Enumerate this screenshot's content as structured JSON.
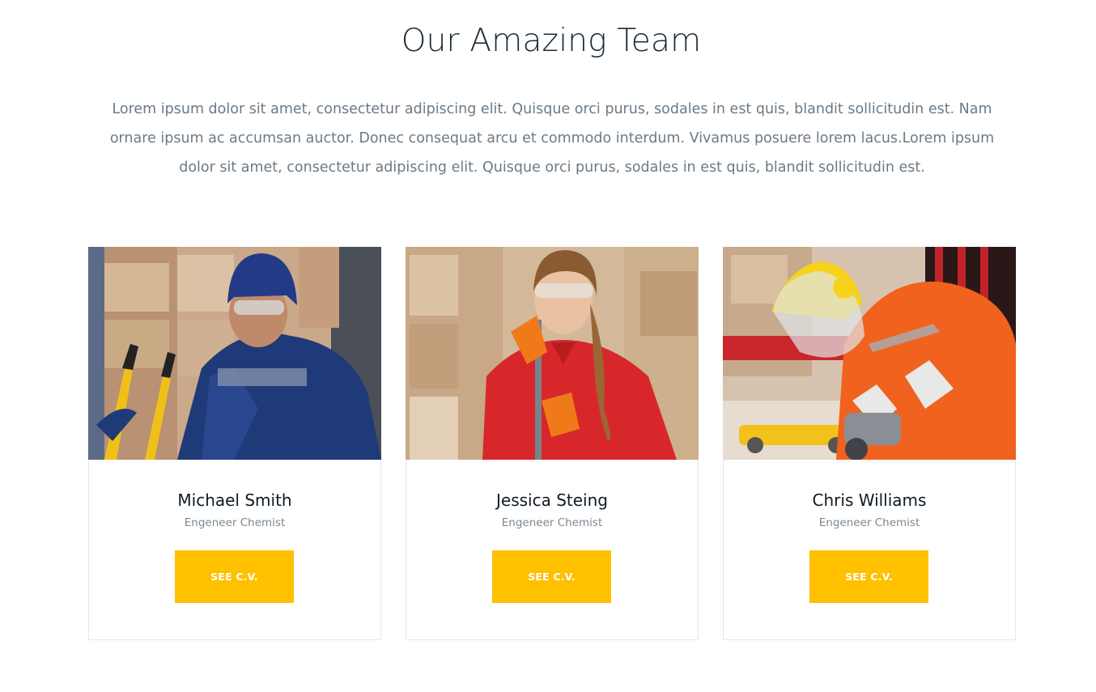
{
  "section": {
    "title": "Our Amazing Team",
    "intro": "Lorem ipsum dolor sit amet, consectetur adipiscing elit. Quisque orci purus, sodales in est quis, blandit sollicitudin est. Nam ornare ipsum ac accumsan auctor. Donec consequat arcu et commodo interdum. Vivamus posuere lorem lacus.Lorem ipsum dolor sit amet, consectetur adipiscing elit. Quisque orci purus, sodales in est quis, blandit sollicitudin est."
  },
  "team": [
    {
      "name": "Michael Smith",
      "role": "Engeneer Chemist",
      "button": "SEE C.V."
    },
    {
      "name": "Jessica Steing",
      "role": "Engeneer Chemist",
      "button": "SEE C.V."
    },
    {
      "name": "Chris Williams",
      "role": "Engeneer Chemist",
      "button": "SEE C.V."
    }
  ],
  "colors": {
    "accent": "#ffc000",
    "title": "#1c2b36",
    "text": "#6b7a86",
    "card_border": "#dce8f1"
  }
}
